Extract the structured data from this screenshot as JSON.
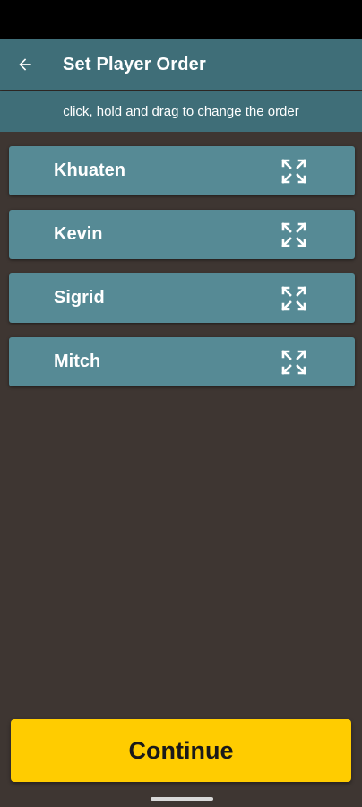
{
  "app_bar": {
    "back_icon": "arrow-left-icon",
    "title": "Set Player Order"
  },
  "instructions": "click, hold and drag to change the order",
  "players": [
    {
      "name": "Khuaten",
      "icon": "drag-handle-icon"
    },
    {
      "name": "Kevin",
      "icon": "drag-handle-icon"
    },
    {
      "name": "Sigrid",
      "icon": "drag-handle-icon"
    },
    {
      "name": "Mitch",
      "icon": "drag-handle-icon"
    }
  ],
  "continue_label": "Continue",
  "colors": {
    "app_bar": "#3f6e78",
    "row": "#568a95",
    "background": "#3e3632",
    "accent": "#ffcc00"
  }
}
